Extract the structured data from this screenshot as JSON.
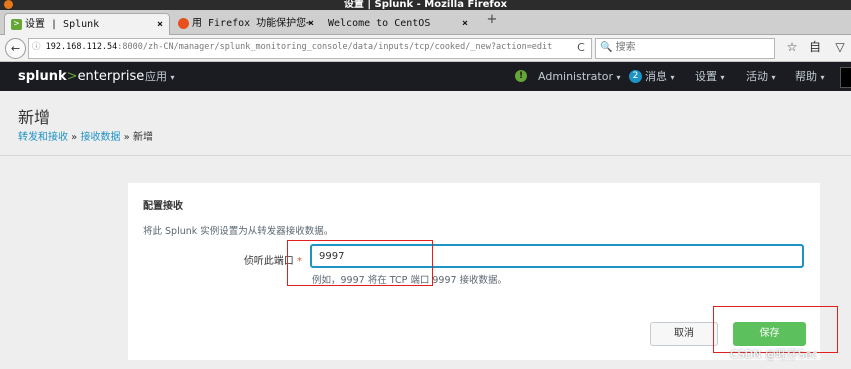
{
  "window": {
    "title": "设置 | Splunk - Mozilla Firefox"
  },
  "tabs": [
    {
      "label": "设置 | Splunk",
      "close": "×",
      "icon": "splunk-tab-icon",
      "active": true
    },
    {
      "label": "用 Firefox 功能保护您⋯",
      "close": "×",
      "icon": "firefox-tab-icon",
      "active": false
    },
    {
      "label": "Welcome to CentOS",
      "close": "×",
      "icon": "none",
      "active": false
    }
  ],
  "newtab_label": "+",
  "nav": {
    "back": "←",
    "info": "ⓘ",
    "url_host": "192.168.112.54",
    "url_path": ":8000/zh-CN/manager/splunk_monitoring_console/data/inputs/tcp/cooked/_new?action=edit",
    "reload": "C",
    "search_placeholder": "搜索",
    "star": "☆",
    "bookmarks": "自",
    "pocket": "▽"
  },
  "splunk": {
    "logo_main": "splunk",
    "logo_arrow": ">",
    "logo_sub": "enterprise",
    "apps_menu": "应用",
    "user_menu": "Administrator",
    "info_badge": "!",
    "messages_count": "2",
    "messages_menu": "消息",
    "settings_menu": "设置",
    "activity_menu": "活动",
    "help_menu": "帮助",
    "caret": "▾"
  },
  "page": {
    "title": "新增",
    "breadcrumb": {
      "item1": "转发和接收",
      "sep": " » ",
      "item2": "接收数据",
      "current": "新增"
    }
  },
  "form": {
    "section_title": "配置接收",
    "description": "将此 Splunk 实例设置为从转发器接收数据。",
    "port_label": "侦听此端口",
    "required_mark": "*",
    "port_value": "9997",
    "help_text": "例如，9997 将在 TCP 端口 9997 接收数据。",
    "cancel_label": "取消",
    "save_label": "保存"
  },
  "watermark": "CSDN @旺仔Sec",
  "colors": {
    "accent": "#1e93c6",
    "save": "#5cc05c",
    "splunk_green": "#65a637",
    "annotation": "#e02020"
  }
}
